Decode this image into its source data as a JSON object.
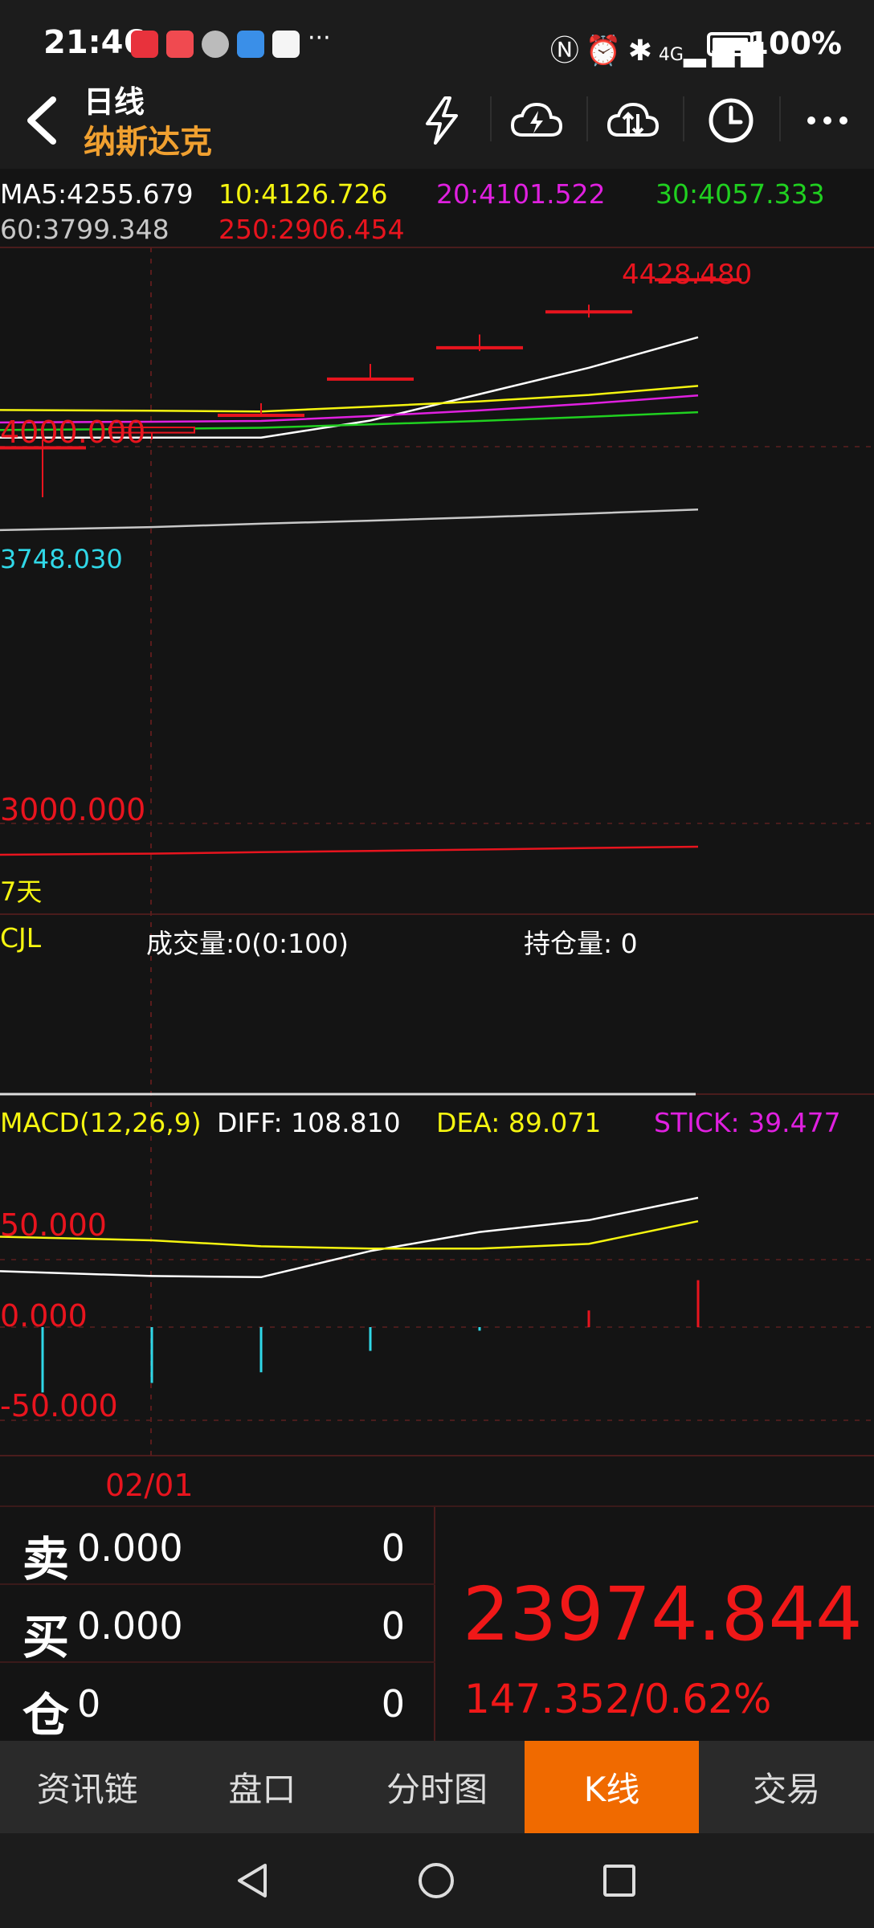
{
  "status": {
    "time": "21:46",
    "battery": "100%",
    "network": "4G"
  },
  "header": {
    "title": "日线",
    "subtitle": "纳斯达克"
  },
  "ma": {
    "ma5": "MA5:4255.679",
    "ma10": "10:4126.726",
    "ma20": "20:4101.522",
    "ma30": "30:4057.333",
    "ma60": "60:3799.348",
    "ma250": "250:2906.454"
  },
  "colors": {
    "ma5": "#ffffff",
    "ma10": "#f5f510",
    "ma20": "#e020e0",
    "ma30": "#20d020",
    "ma60": "#c8c8c8",
    "ma250": "#e8141e",
    "up": "#e8141e",
    "down": "#30d8e8"
  },
  "price_axis": {
    "high_mark": "4428.480",
    "level_4000": "4000.000",
    "low_mark": "3748.030",
    "level_3000": "3000.000",
    "period": "7天"
  },
  "cjl": {
    "label": "CJL",
    "volume": "成交量:0(0:100)",
    "open_interest": "持仓量: 0"
  },
  "macd": {
    "label": "MACD(12,26,9)",
    "diff": "DIFF: 108.810",
    "dea": "DEA: 89.071",
    "stick": "STICK: 39.477",
    "axis_50": "50.000",
    "axis_0": "0.000",
    "axis_neg50": "-50.000"
  },
  "date_label": "02/01",
  "chart_data": {
    "type": "candlestick",
    "candles": [
      {
        "open": 3965,
        "close": 3965,
        "high": 3985,
        "low": 3832
      },
      {
        "open": 4003,
        "close": 4017,
        "high": 4019,
        "low": 3985
      },
      {
        "open": 4051,
        "close": 4051,
        "high": 4081,
        "low": 4051
      },
      {
        "open": 4147,
        "close": 4147,
        "high": 4185,
        "low": 4147
      },
      {
        "open": 4230,
        "close": 4230,
        "high": 4263,
        "low": 4219
      },
      {
        "open": 4325,
        "close": 4325,
        "high": 4342,
        "low": 4308
      },
      {
        "open": 4410,
        "close": 4410,
        "high": 4428.48,
        "low": 4410
      }
    ],
    "ma_lines": {
      "MA5": [
        3990,
        3990,
        3990,
        4035,
        4105,
        4175,
        4255.679
      ],
      "MA10": [
        4063,
        4061,
        4059,
        4072,
        4086,
        4103,
        4126.726
      ],
      "MA20": [
        4030,
        4032,
        4034,
        4047,
        4062,
        4080,
        4101.522
      ],
      "MA30": [
        4010,
        4013,
        4016,
        4025,
        4034,
        4045,
        4057.333
      ],
      "MA60": [
        3745,
        3753,
        3762,
        3770,
        3779,
        3789,
        3799.348
      ],
      "MA250": [
        2885,
        2888,
        2892,
        2895,
        2899,
        2903,
        2906.454
      ]
    },
    "macd": {
      "diff": [
        47,
        43,
        42,
        64,
        80,
        90,
        108.81
      ],
      "dea": [
        76,
        73,
        68,
        66,
        66,
        70,
        89.071
      ],
      "stick": [
        -55,
        -47,
        -38,
        -20,
        -3,
        14,
        39.477
      ]
    },
    "y_levels": [
      3000,
      4000
    ]
  },
  "quote": {
    "sell_label": "卖",
    "sell_price": "0.000",
    "sell_vol": "0",
    "buy_label": "买",
    "buy_price": "0.000",
    "buy_vol": "0",
    "pos_label": "仓",
    "pos_value": "0",
    "pos_vol": "0",
    "last_price": "23974.844",
    "change": "147.352/0.62%"
  },
  "tabs": [
    "资讯链",
    "盘口",
    "分时图",
    "K线",
    "交易"
  ]
}
